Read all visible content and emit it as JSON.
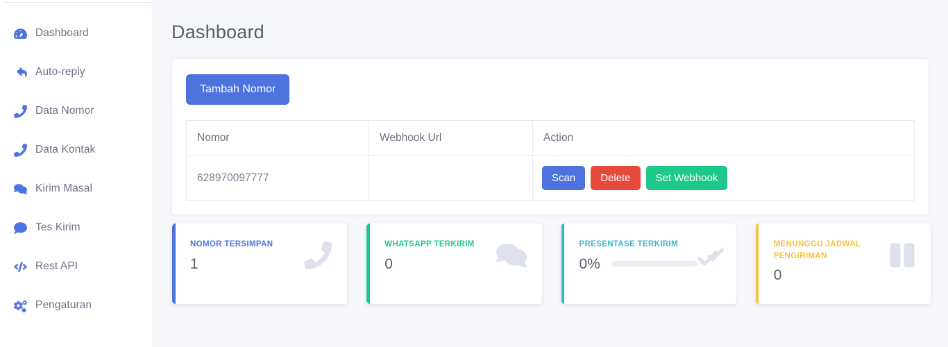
{
  "sidebar": {
    "items": [
      {
        "label": "Dashboard",
        "icon": "tachometer-icon",
        "name": "sidebar-item-dashboard"
      },
      {
        "label": "Auto-reply",
        "icon": "reply-all-icon",
        "name": "sidebar-item-auto-reply"
      },
      {
        "label": "Data Nomor",
        "icon": "phone-icon",
        "name": "sidebar-item-data-nomor"
      },
      {
        "label": "Data Kontak",
        "icon": "phone-icon",
        "name": "sidebar-item-data-kontak"
      },
      {
        "label": "Kirim Masal",
        "icon": "comments-icon",
        "name": "sidebar-item-kirim-masal"
      },
      {
        "label": "Tes Kirim",
        "icon": "comment-icon",
        "name": "sidebar-item-tes-kirim"
      },
      {
        "label": "Rest API",
        "icon": "code-icon",
        "name": "sidebar-item-rest-api"
      },
      {
        "label": "Pengaturan",
        "icon": "cogs-icon",
        "name": "sidebar-item-pengaturan"
      }
    ]
  },
  "page": {
    "title": "Dashboard"
  },
  "panel": {
    "add_button_label": "Tambah Nomor",
    "table": {
      "headers": [
        "Nomor",
        "Webhook Url",
        "Action"
      ],
      "rows": [
        {
          "nomor": "628970097777",
          "webhook_url": "",
          "actions": [
            {
              "label": "Scan",
              "style": "primary"
            },
            {
              "label": "Delete",
              "style": "danger"
            },
            {
              "label": "Set Webhook",
              "style": "success"
            }
          ]
        }
      ]
    }
  },
  "stats": [
    {
      "label": "NOMOR TERSIMPAN",
      "value": "1",
      "accent": "#4e73df",
      "icon": "phone-icon",
      "has_progress": false
    },
    {
      "label": "WHATSAPP TERKIRIM",
      "value": "0",
      "accent": "#1cc88a",
      "icon": "comments-icon",
      "has_progress": false
    },
    {
      "label": "PRESENTASE TERKIRIM",
      "value": "0%",
      "accent": "#36b9cc",
      "icon": "double-check-icon",
      "has_progress": true,
      "progress_percent": 0
    },
    {
      "label": "MENUNGGU JADWAL PENGIRIMAN",
      "value": "0",
      "accent": "#f6c23e",
      "icon": "pause-icon",
      "has_progress": false
    }
  ]
}
